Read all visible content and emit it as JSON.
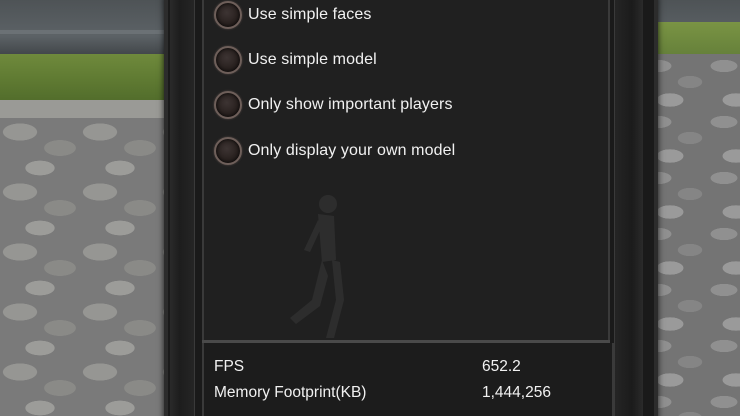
{
  "options": [
    {
      "label": "Use simple faces",
      "selected": false
    },
    {
      "label": "Use simple model",
      "selected": false
    },
    {
      "label": "Only show important players",
      "selected": false
    },
    {
      "label": "Only display your own model",
      "selected": false
    }
  ],
  "stats": [
    {
      "label": "FPS",
      "value": "652.2"
    },
    {
      "label": "Memory Footprint(KB)",
      "value": "1,444,256"
    }
  ],
  "colors": {
    "panel_background": "#202020",
    "text": "#f1f1f1",
    "radio_ring": "#6e5f5a"
  }
}
